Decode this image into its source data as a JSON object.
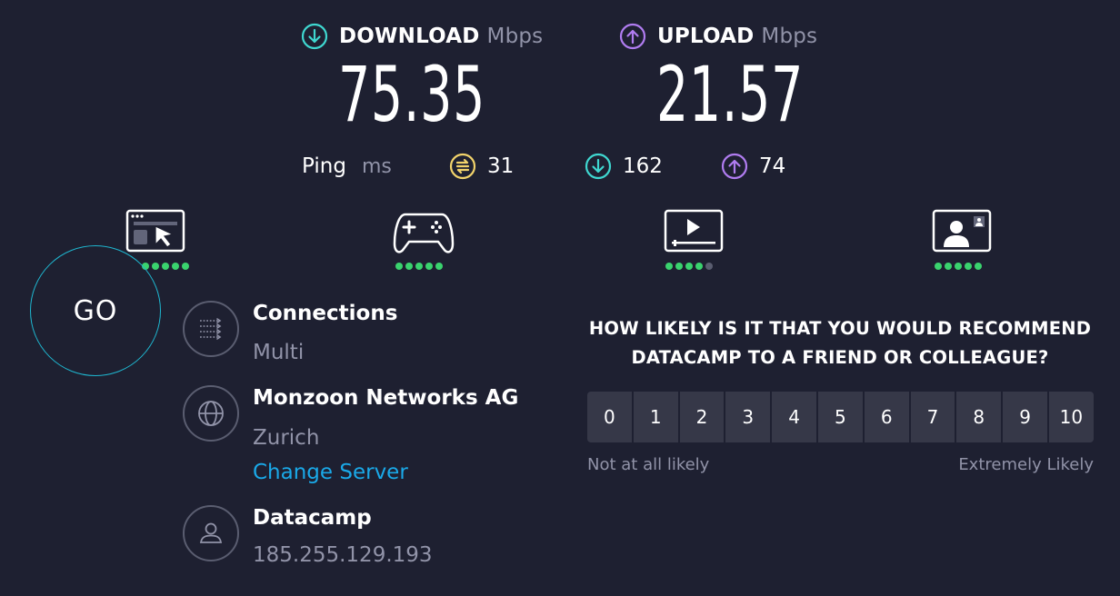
{
  "download": {
    "label": "DOWNLOAD",
    "unit": "Mbps",
    "value": "75.35",
    "icon": "arrow-down-circle-icon",
    "color": "#3fd7d0"
  },
  "upload": {
    "label": "UPLOAD",
    "unit": "Mbps",
    "value": "21.57",
    "icon": "arrow-up-circle-icon",
    "color": "#b07cf0"
  },
  "ping": {
    "label": "Ping",
    "unit": "ms",
    "idle": {
      "value": "31",
      "icon": "ping-idle-icon",
      "color": "#f2d36b"
    },
    "download": {
      "value": "162",
      "icon": "arrow-down-circle-icon",
      "color": "#3fd7d0"
    },
    "upload": {
      "value": "74",
      "icon": "arrow-up-circle-icon",
      "color": "#b07cf0"
    }
  },
  "activities": [
    {
      "icon": "web-browsing-icon",
      "rating": 5
    },
    {
      "icon": "gaming-icon",
      "rating": 5
    },
    {
      "icon": "video-streaming-icon",
      "rating": 4
    },
    {
      "icon": "video-call-icon",
      "rating": 5
    }
  ],
  "go_label": "GO",
  "connections": {
    "title": "Connections",
    "value": "Multi",
    "icon": "connections-icon"
  },
  "isp": {
    "title": "Monzoon Networks AG",
    "location": "Zurich",
    "change_label": "Change Server",
    "icon": "globe-icon"
  },
  "host": {
    "title": "Datacamp",
    "ip": "185.255.129.193",
    "icon": "user-icon"
  },
  "survey": {
    "question_line1": "HOW LIKELY IS IT THAT YOU WOULD RECOMMEND",
    "question_line2": "DATACAMP TO A FRIEND OR COLLEAGUE?",
    "scale": [
      "0",
      "1",
      "2",
      "3",
      "4",
      "5",
      "6",
      "7",
      "8",
      "9",
      "10"
    ],
    "low_label": "Not at all likely",
    "high_label": "Extremely Likely"
  }
}
